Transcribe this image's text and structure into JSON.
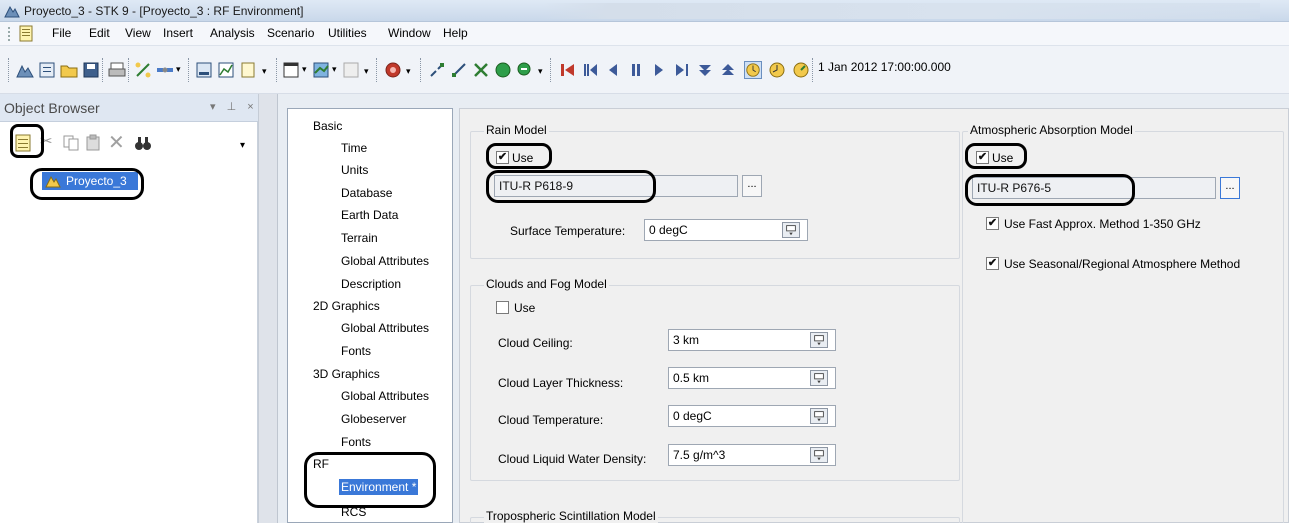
{
  "window": {
    "title": "Proyecto_3 - STK 9 - [Proyecto_3 : RF Environment]"
  },
  "menu": {
    "items": [
      "File",
      "Edit",
      "View",
      "Insert",
      "Analysis",
      "Scenario",
      "Utilities",
      "Window",
      "Help"
    ]
  },
  "toolbar": {
    "time": "1 Jan 2012 17:00:00.000"
  },
  "object_browser": {
    "title": "Object Browser",
    "controls": "▾ ⊥ ×",
    "project_item": "Proyecto_3"
  },
  "nav_tree": {
    "items": [
      {
        "label": "Basic",
        "level": 0
      },
      {
        "label": "Time",
        "level": 1
      },
      {
        "label": "Units",
        "level": 1
      },
      {
        "label": "Database",
        "level": 1
      },
      {
        "label": "Earth Data",
        "level": 1
      },
      {
        "label": "Terrain",
        "level": 1
      },
      {
        "label": "Global Attributes",
        "level": 1
      },
      {
        "label": "Description",
        "level": 1
      },
      {
        "label": "2D Graphics",
        "level": 0
      },
      {
        "label": "Global Attributes",
        "level": 1
      },
      {
        "label": "Fonts",
        "level": 1
      },
      {
        "label": "3D Graphics",
        "level": 0
      },
      {
        "label": "Global Attributes",
        "level": 1
      },
      {
        "label": "Globeserver",
        "level": 1
      },
      {
        "label": "Fonts",
        "level": 1
      },
      {
        "label": "RF",
        "level": 0
      },
      {
        "label": "Environment *",
        "level": 1,
        "selected": true
      },
      {
        "label": "RCS",
        "level": 1
      }
    ]
  },
  "rain": {
    "title": "Rain Model",
    "use_label": "Use",
    "use_checked": true,
    "model": "ITU-R P618-9",
    "button": "...",
    "surface_temp_label": "Surface Temperature:",
    "surface_temp_value": "0 degC"
  },
  "clouds": {
    "title": "Clouds and Fog Model",
    "use_label": "Use",
    "use_checked": false,
    "ceiling_label": "Cloud Ceiling:",
    "ceiling_value": "3 km",
    "thickness_label": "Cloud Layer Thickness:",
    "thickness_value": "0.5 km",
    "temperature_label": "Cloud Temperature:",
    "temperature_value": "0 degC",
    "density_label": "Cloud Liquid Water Density:",
    "density_value": "7.5 g/m^3"
  },
  "troposcatter": {
    "title": "Tropospheric Scintillation Model"
  },
  "atmospheric": {
    "title": "Atmospheric Absorption Model",
    "use_label": "Use",
    "use_checked": true,
    "model": "ITU-R P676-5",
    "button": "...",
    "fast_label": "Use Fast Approx. Method 1-350 GHz",
    "fast_checked": true,
    "seasonal_label": "Use Seasonal/Regional Atmosphere Method",
    "seasonal_checked": true
  },
  "colors": {
    "selection": "#3a78d8",
    "annotation": "#000000"
  }
}
